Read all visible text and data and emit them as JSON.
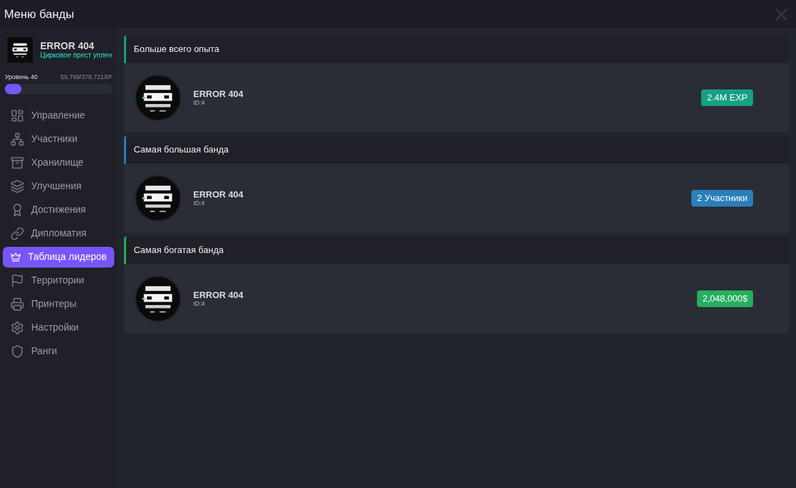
{
  "window": {
    "title": "Меню банды"
  },
  "gang": {
    "name": "ERROR 404",
    "subtitle": "Цирковое прест уплен",
    "level_label": "Уровень 40",
    "xp": "59,799/378,721XP",
    "level": 0.158
  },
  "sidebar": {
    "items": [
      {
        "label": "Управление",
        "selected": false
      },
      {
        "label": "Участники",
        "selected": false
      },
      {
        "label": "Хранилище",
        "selected": false
      },
      {
        "label": "Улучшения",
        "selected": false
      },
      {
        "label": "Достижения",
        "selected": false
      },
      {
        "label": "Дипломатия",
        "selected": false
      },
      {
        "label": "Таблица лидеров",
        "selected": true
      },
      {
        "label": "Территории",
        "selected": false
      },
      {
        "label": "Принтеры",
        "selected": false
      },
      {
        "label": "Настройки",
        "selected": false
      },
      {
        "label": "Ранги",
        "selected": false
      }
    ]
  },
  "leaderboards": [
    {
      "title": "Больше всего опыта",
      "color": "#16a085",
      "name": "ERROR 404",
      "id": "ID:4",
      "value": "2.4M EXP"
    },
    {
      "title": "Самая большая банда",
      "color": "#2980b9",
      "name": "ERROR 404",
      "id": "ID:4",
      "value": "2 Участники"
    },
    {
      "title": "Самая богатая банда",
      "color": "#27ae60",
      "name": "ERROR 404",
      "id": "ID:4",
      "value": "2,048,000$"
    }
  ]
}
